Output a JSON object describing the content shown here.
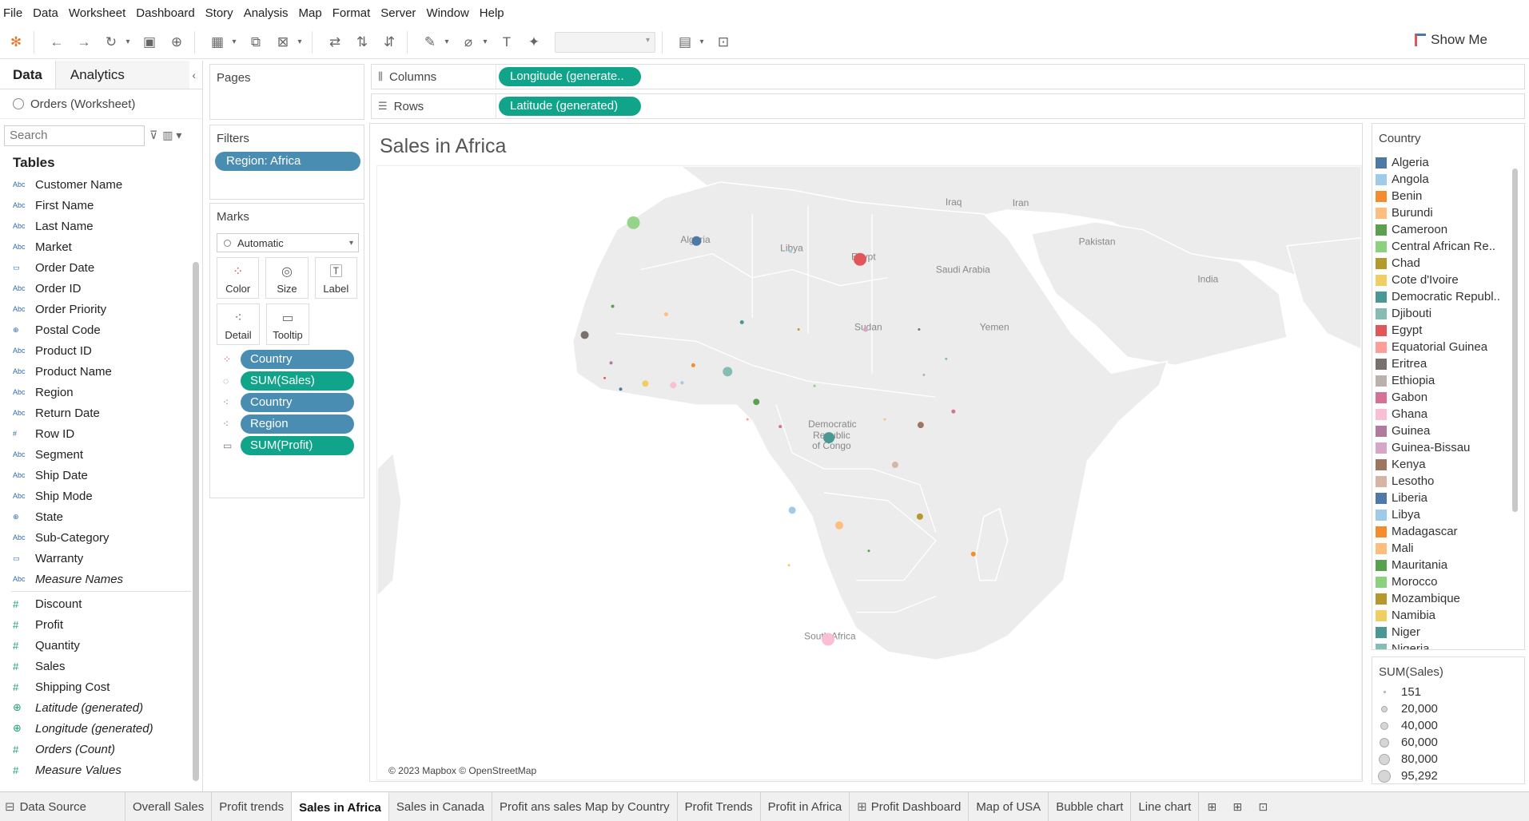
{
  "menu": [
    "File",
    "Data",
    "Worksheet",
    "Dashboard",
    "Story",
    "Analysis",
    "Map",
    "Format",
    "Server",
    "Window",
    "Help"
  ],
  "toolbar": {
    "show_me": "Show Me"
  },
  "data_pane": {
    "tab_data": "Data",
    "tab_analytics": "Analytics",
    "datasource": "Orders (Worksheet)",
    "search_placeholder": "Search",
    "tables_heading": "Tables",
    "dimensions": [
      {
        "type": "Abc",
        "name": "Customer Name",
        "italic": false
      },
      {
        "type": "Abc",
        "name": "First Name",
        "italic": false
      },
      {
        "type": "Abc",
        "name": "Last Name",
        "italic": false
      },
      {
        "type": "Abc",
        "name": "Market",
        "italic": false
      },
      {
        "type": "date",
        "name": "Order Date",
        "italic": false
      },
      {
        "type": "Abc",
        "name": "Order ID",
        "italic": false
      },
      {
        "type": "Abc",
        "name": "Order Priority",
        "italic": false
      },
      {
        "type": "geo",
        "name": "Postal Code",
        "italic": false
      },
      {
        "type": "Abc",
        "name": "Product ID",
        "italic": false
      },
      {
        "type": "Abc",
        "name": "Product Name",
        "italic": false
      },
      {
        "type": "Abc",
        "name": "Region",
        "italic": false
      },
      {
        "type": "Abc",
        "name": "Return Date",
        "italic": false
      },
      {
        "type": "#",
        "name": "Row ID",
        "italic": false
      },
      {
        "type": "Abc",
        "name": "Segment",
        "italic": false
      },
      {
        "type": "Abc",
        "name": "Ship Date",
        "italic": false
      },
      {
        "type": "Abc",
        "name": "Ship Mode",
        "italic": false
      },
      {
        "type": "geo",
        "name": "State",
        "italic": false
      },
      {
        "type": "Abc",
        "name": "Sub-Category",
        "italic": false
      },
      {
        "type": "date",
        "name": "Warranty",
        "italic": false
      },
      {
        "type": "Abc",
        "name": "Measure Names",
        "italic": true
      }
    ],
    "measures": [
      {
        "type": "#",
        "name": "Discount",
        "italic": false
      },
      {
        "type": "#",
        "name": "Profit",
        "italic": false
      },
      {
        "type": "#",
        "name": "Quantity",
        "italic": false
      },
      {
        "type": "#",
        "name": "Sales",
        "italic": false
      },
      {
        "type": "#",
        "name": "Shipping Cost",
        "italic": false
      },
      {
        "type": "geo",
        "name": "Latitude (generated)",
        "italic": true
      },
      {
        "type": "geo",
        "name": "Longitude (generated)",
        "italic": true
      },
      {
        "type": "#",
        "name": "Orders (Count)",
        "italic": true
      },
      {
        "type": "#",
        "name": "Measure Values",
        "italic": true
      }
    ]
  },
  "pages": {
    "title": "Pages"
  },
  "filters": {
    "title": "Filters",
    "pill": "Region: Africa"
  },
  "marks": {
    "title": "Marks",
    "mark_type": "Automatic",
    "buttons": [
      "Color",
      "Size",
      "Label",
      "Detail",
      "Tooltip"
    ],
    "pills": [
      {
        "icon": "color",
        "label": "Country",
        "kind": "dim"
      },
      {
        "icon": "size",
        "label": "SUM(Sales)",
        "kind": "mea"
      },
      {
        "icon": "detail",
        "label": "Country",
        "kind": "dim"
      },
      {
        "icon": "detail",
        "label": "Region",
        "kind": "dim"
      },
      {
        "icon": "tooltip",
        "label": "SUM(Profit)",
        "kind": "mea"
      }
    ]
  },
  "shelves": {
    "columns_label": "Columns",
    "columns_pill": "Longitude (generate..",
    "rows_label": "Rows",
    "rows_pill": "Latitude (generated)"
  },
  "view": {
    "title": "Sales in Africa",
    "attribution": "© 2023 Mapbox © OpenStreetMap",
    "map_labels": [
      "Algeria",
      "Libya",
      "Egypt",
      "Iraq",
      "Iran",
      "Pakistan",
      "Saudi Arabia",
      "Yemen",
      "India",
      "Sudan",
      "Democratic",
      "Republic",
      "of Congo",
      "South Africa"
    ]
  },
  "legend": {
    "title": "Country",
    "items": [
      {
        "name": "Algeria",
        "color": "#4e79a7"
      },
      {
        "name": "Angola",
        "color": "#a0cbe8"
      },
      {
        "name": "Benin",
        "color": "#f28e2b"
      },
      {
        "name": "Burundi",
        "color": "#ffbe7d"
      },
      {
        "name": "Cameroon",
        "color": "#59a14f"
      },
      {
        "name": "Central African Re..",
        "color": "#8cd17d"
      },
      {
        "name": "Chad",
        "color": "#b6992d"
      },
      {
        "name": "Cote d'Ivoire",
        "color": "#f1ce63"
      },
      {
        "name": "Democratic Republ..",
        "color": "#499894"
      },
      {
        "name": "Djibouti",
        "color": "#86bcb6"
      },
      {
        "name": "Egypt",
        "color": "#e15759"
      },
      {
        "name": "Equatorial Guinea",
        "color": "#ff9d9a"
      },
      {
        "name": "Eritrea",
        "color": "#79706e"
      },
      {
        "name": "Ethiopia",
        "color": "#bab0ac"
      },
      {
        "name": "Gabon",
        "color": "#d37295"
      },
      {
        "name": "Ghana",
        "color": "#fabfd2"
      },
      {
        "name": "Guinea",
        "color": "#b07aa1"
      },
      {
        "name": "Guinea-Bissau",
        "color": "#d4a6c8"
      },
      {
        "name": "Kenya",
        "color": "#9d7660"
      },
      {
        "name": "Lesotho",
        "color": "#d7b5a6"
      },
      {
        "name": "Liberia",
        "color": "#4e79a7"
      },
      {
        "name": "Libya",
        "color": "#a0cbe8"
      },
      {
        "name": "Madagascar",
        "color": "#f28e2b"
      },
      {
        "name": "Mali",
        "color": "#ffbe7d"
      },
      {
        "name": "Mauritania",
        "color": "#59a14f"
      },
      {
        "name": "Morocco",
        "color": "#8cd17d"
      },
      {
        "name": "Mozambique",
        "color": "#b6992d"
      },
      {
        "name": "Namibia",
        "color": "#f1ce63"
      },
      {
        "name": "Niger",
        "color": "#499894"
      },
      {
        "name": "Nigeria",
        "color": "#86bcb6"
      }
    ]
  },
  "size_legend": {
    "title": "SUM(Sales)",
    "items": [
      "151",
      "20,000",
      "40,000",
      "60,000",
      "80,000",
      "95,292"
    ]
  },
  "bottom_tabs": {
    "datasource": "Data Source",
    "sheets": [
      "Overall Sales",
      "Profit trends",
      "Sales in Africa",
      "Sales in Canada",
      "Profit ans sales Map by Country",
      "Profit Trends",
      "Profit in Africa",
      "Profit Dashboard",
      "Map of USA",
      "Bubble chart",
      "Line chart"
    ],
    "active": "Sales in Africa"
  }
}
